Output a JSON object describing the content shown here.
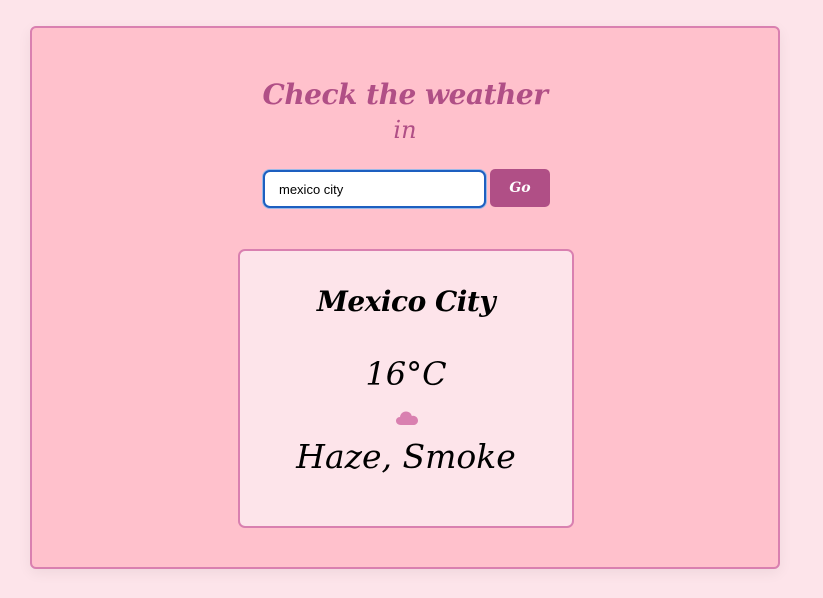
{
  "header": {
    "title": "Check the weather",
    "subtitle": "in"
  },
  "search": {
    "value": "mexico city",
    "button_label": "Go"
  },
  "weather": {
    "city": "Mexico City",
    "temperature": "16°C",
    "icon": "cloud-icon",
    "description": "Haze, Smoke"
  },
  "colors": {
    "background": "#fde4ea",
    "panel": "#ffc1cc",
    "accent": "#b04f86",
    "border": "#d980b0",
    "icon": "#d980b0"
  }
}
